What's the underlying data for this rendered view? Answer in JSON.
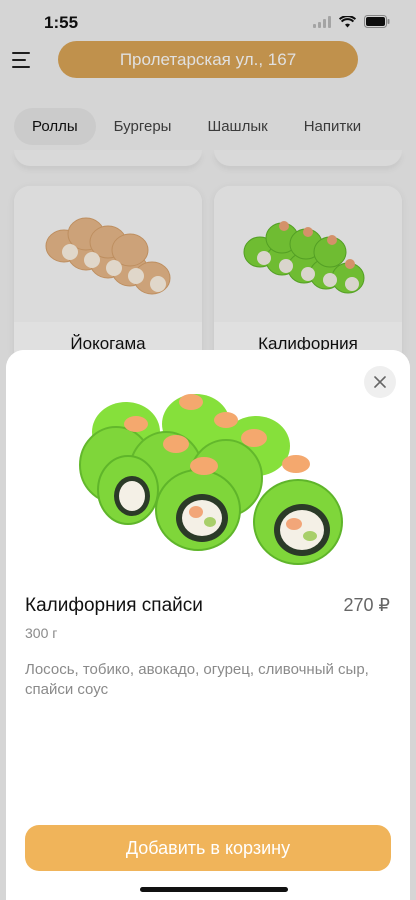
{
  "status": {
    "time": "1:55"
  },
  "header": {
    "address": "Пролетарская ул., 167"
  },
  "tabs": [
    {
      "label": "Роллы",
      "active": true
    },
    {
      "label": "Бургеры",
      "active": false
    },
    {
      "label": "Шашлык",
      "active": false
    },
    {
      "label": "Напитки",
      "active": false
    }
  ],
  "cards": [
    {
      "title": "Йокогама"
    },
    {
      "title": "Калифорния"
    }
  ],
  "product": {
    "name": "Калифорния спайси",
    "price": "270 ₽",
    "weight": "300 г",
    "description": "Лосось, тобико, авокадо, огурец, сливочный сыр, спайси соус",
    "add_button": "Добавить в корзину"
  },
  "colors": {
    "accent": "#f0b45a",
    "address_pill": "#dba657",
    "roll_green": "#7fd63a"
  }
}
